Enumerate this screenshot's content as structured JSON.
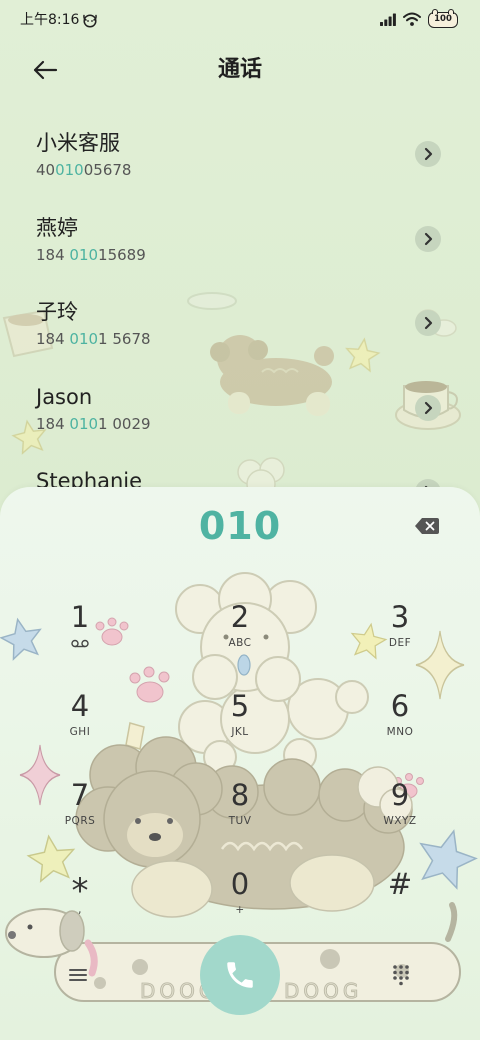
{
  "status_bar": {
    "time": "上午8:16",
    "battery_level": "100",
    "icons": [
      "dog-face-icon",
      "signal-icon",
      "wifi-icon",
      "battery-icon"
    ]
  },
  "header": {
    "back_icon": "back-arrow-icon",
    "title": "通话"
  },
  "contacts": [
    {
      "name": "小米客服",
      "number_prefix": "40",
      "number_match": "010",
      "number_suffix": "05678"
    },
    {
      "name": "燕婷",
      "number_prefix": "184 ",
      "number_match": "010",
      "number_suffix": "15689"
    },
    {
      "name": "子玲",
      "number_prefix": "184 ",
      "number_match": "010",
      "number_suffix": "1 5678"
    },
    {
      "name": "Jason",
      "number_prefix": "184 ",
      "number_match": "010",
      "number_suffix": "1 0029"
    },
    {
      "name": "Stephanie"
    }
  ],
  "dialer": {
    "input": "010",
    "backspace_icon": "backspace-icon"
  },
  "keypad": [
    {
      "digit": "1",
      "sub_icon": "voicemail-icon"
    },
    {
      "digit": "2",
      "letters": "ABC"
    },
    {
      "digit": "3",
      "letters": "DEF"
    },
    {
      "digit": "4",
      "letters": "GHI"
    },
    {
      "digit": "5",
      "letters": "JKL"
    },
    {
      "digit": "6",
      "letters": "MNO"
    },
    {
      "digit": "7",
      "letters": "PQRS"
    },
    {
      "digit": "8",
      "letters": "TUV"
    },
    {
      "digit": "9",
      "letters": "WXYZ"
    },
    {
      "digit": "*",
      "letters": ","
    },
    {
      "digit": "0",
      "letters": "+"
    },
    {
      "digit": "#"
    }
  ],
  "bottom_bar": {
    "menu_icon": "menu-icon",
    "call_icon": "phone-icon",
    "dialpad_icon": "dialpad-icon"
  },
  "wallpaper": {
    "lettering": [
      "DOOG",
      "DOOG"
    ]
  },
  "colors": {
    "background": "#e0efd5",
    "panel": "#edf6ea",
    "accent": "#4fb3a2",
    "call_button": "#a2d8cb",
    "text": "#2b2b2b"
  }
}
